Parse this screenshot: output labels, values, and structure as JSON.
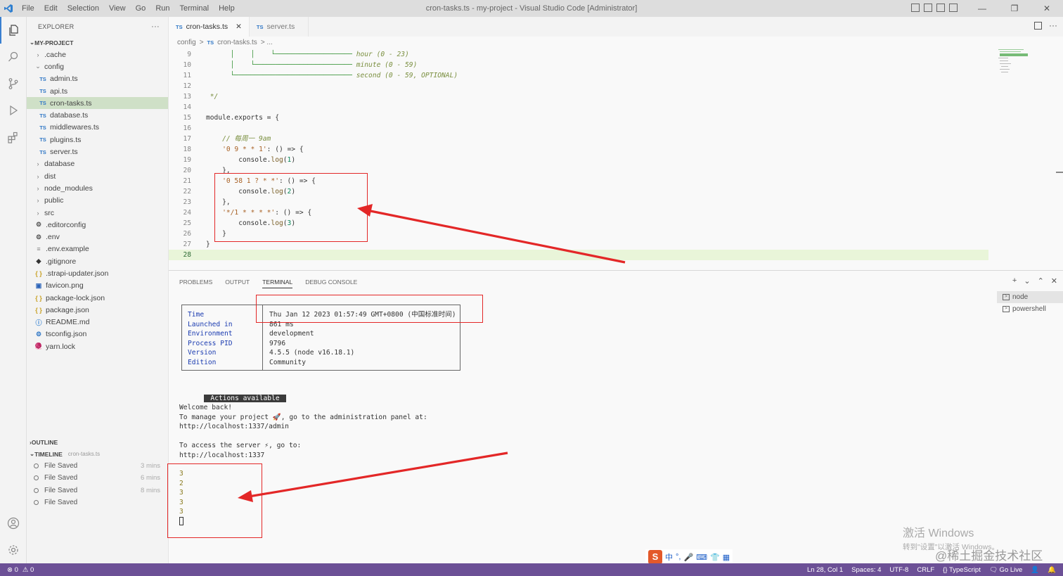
{
  "window": {
    "title": "cron-tasks.ts - my-project - Visual Studio Code [Administrator]",
    "menu": [
      "File",
      "Edit",
      "Selection",
      "View",
      "Go",
      "Run",
      "Terminal",
      "Help"
    ],
    "controls": [
      "—",
      "❐",
      "✕"
    ]
  },
  "sidebar": {
    "header": "EXPLORER",
    "more": "···",
    "project": "MY-PROJECT",
    "items": [
      {
        "label": ".cache",
        "icon": "folder-icon",
        "kind": "folder",
        "expanded": false,
        "indent": 1
      },
      {
        "label": "config",
        "icon": "folder-icon",
        "kind": "folder",
        "expanded": true,
        "indent": 1
      },
      {
        "label": "admin.ts",
        "icon": "ts-file-icon",
        "kind": "ts",
        "indent": 2
      },
      {
        "label": "api.ts",
        "icon": "ts-file-icon",
        "kind": "ts",
        "indent": 2
      },
      {
        "label": "cron-tasks.ts",
        "icon": "ts-file-icon",
        "kind": "ts",
        "indent": 2,
        "selected": true
      },
      {
        "label": "database.ts",
        "icon": "ts-file-icon",
        "kind": "ts",
        "indent": 2
      },
      {
        "label": "middlewares.ts",
        "icon": "ts-file-icon",
        "kind": "ts",
        "indent": 2
      },
      {
        "label": "plugins.ts",
        "icon": "ts-file-icon",
        "kind": "ts",
        "indent": 2
      },
      {
        "label": "server.ts",
        "icon": "ts-file-icon",
        "kind": "ts",
        "indent": 2
      },
      {
        "label": "database",
        "icon": "folder-icon",
        "kind": "folder",
        "expanded": false,
        "indent": 1
      },
      {
        "label": "dist",
        "icon": "folder-icon",
        "kind": "folder",
        "expanded": false,
        "indent": 1
      },
      {
        "label": "node_modules",
        "icon": "folder-icon",
        "kind": "folder",
        "expanded": false,
        "indent": 1
      },
      {
        "label": "public",
        "icon": "folder-icon",
        "kind": "folder",
        "expanded": false,
        "indent": 1
      },
      {
        "label": "src",
        "icon": "folder-icon",
        "kind": "folder",
        "expanded": false,
        "indent": 1
      },
      {
        "label": ".editorconfig",
        "icon": "gear-icon",
        "kind": "gear",
        "indent": 1
      },
      {
        "label": ".env",
        "icon": "gear-icon",
        "kind": "gear",
        "indent": 1
      },
      {
        "label": ".env.example",
        "icon": "text-file-icon",
        "kind": "text",
        "indent": 1
      },
      {
        "label": ".gitignore",
        "icon": "git-icon",
        "kind": "git",
        "indent": 1
      },
      {
        "label": ".strapi-updater.json",
        "icon": "json-icon",
        "kind": "json",
        "indent": 1
      },
      {
        "label": "favicon.png",
        "icon": "image-icon",
        "kind": "image",
        "indent": 1
      },
      {
        "label": "package-lock.json",
        "icon": "json-icon",
        "kind": "json",
        "indent": 1
      },
      {
        "label": "package.json",
        "icon": "json-icon",
        "kind": "json",
        "indent": 1
      },
      {
        "label": "README.md",
        "icon": "markdown-icon",
        "kind": "md",
        "indent": 1
      },
      {
        "label": "tsconfig.json",
        "icon": "tsconfig-icon",
        "kind": "tsconfig",
        "indent": 1
      },
      {
        "label": "yarn.lock",
        "icon": "yarn-icon",
        "kind": "yarn",
        "indent": 1
      }
    ],
    "outline": "OUTLINE",
    "timeline": "TIMELINE",
    "timeline_file": "cron-tasks.ts",
    "timeline_items": [
      {
        "label": "File Saved",
        "ago": "3 mins"
      },
      {
        "label": "File Saved",
        "ago": "6 mins"
      },
      {
        "label": "File Saved",
        "ago": "8 mins"
      },
      {
        "label": "File Saved",
        "ago": ""
      }
    ]
  },
  "tabs": [
    {
      "label": "cron-tasks.ts",
      "badge": "TS",
      "active": true,
      "close": "✕"
    },
    {
      "label": "server.ts",
      "badge": "TS",
      "active": false,
      "close": ""
    }
  ],
  "breadcrumb": {
    "folder": "config",
    "sep": ">",
    "file": "cron-tasks.ts",
    "badge": "TS",
    "tail": "> ..."
  },
  "editor": {
    "current_line": 28,
    "lines": [
      {
        "n": 9,
        "parts": [
          {
            "t": "      │    │    └─────────────────── ",
            "c": "c-guide"
          },
          {
            "t": "hour (0 - 23)",
            "c": "c-comment"
          }
        ]
      },
      {
        "n": 10,
        "parts": [
          {
            "t": "      │    └──────────────────────── ",
            "c": "c-guide"
          },
          {
            "t": "minute (0 - 59)",
            "c": "c-comment"
          }
        ]
      },
      {
        "n": 11,
        "parts": [
          {
            "t": "      └───────────────────────────── ",
            "c": "c-guide"
          },
          {
            "t": "second (0 - 59, OPTIONAL)",
            "c": "c-comment"
          }
        ]
      },
      {
        "n": 12,
        "parts": []
      },
      {
        "n": 13,
        "parts": [
          {
            "t": " */",
            "c": "c-comment"
          }
        ]
      },
      {
        "n": 14,
        "parts": []
      },
      {
        "n": 15,
        "parts": [
          {
            "t": "module.exports = {",
            "c": "c-plain"
          }
        ]
      },
      {
        "n": 16,
        "parts": []
      },
      {
        "n": 17,
        "parts": [
          {
            "t": "    // 每周一 9am",
            "c": "c-comment"
          }
        ]
      },
      {
        "n": 18,
        "parts": [
          {
            "t": "    '0 9 * * 1'",
            "c": "c-str"
          },
          {
            "t": ": () => {",
            "c": "c-plain"
          }
        ]
      },
      {
        "n": 19,
        "parts": [
          {
            "t": "        console.",
            "c": "c-plain"
          },
          {
            "t": "log",
            "c": "c-fn"
          },
          {
            "t": "(",
            "c": "c-plain"
          },
          {
            "t": "1",
            "c": "c-num"
          },
          {
            "t": ")",
            "c": "c-plain"
          }
        ]
      },
      {
        "n": 20,
        "parts": [
          {
            "t": "    },",
            "c": "c-plain"
          }
        ]
      },
      {
        "n": 21,
        "parts": [
          {
            "t": "    '0 58 1 ? * *'",
            "c": "c-str"
          },
          {
            "t": ": () => {",
            "c": "c-plain"
          }
        ]
      },
      {
        "n": 22,
        "parts": [
          {
            "t": "        console.",
            "c": "c-plain"
          },
          {
            "t": "log",
            "c": "c-fn"
          },
          {
            "t": "(",
            "c": "c-plain"
          },
          {
            "t": "2",
            "c": "c-num"
          },
          {
            "t": ")",
            "c": "c-plain"
          }
        ]
      },
      {
        "n": 23,
        "parts": [
          {
            "t": "    },",
            "c": "c-plain"
          }
        ]
      },
      {
        "n": 24,
        "parts": [
          {
            "t": "    '*/1 * * * *'",
            "c": "c-str"
          },
          {
            "t": ": () => {",
            "c": "c-plain"
          }
        ]
      },
      {
        "n": 25,
        "parts": [
          {
            "t": "        console.",
            "c": "c-plain"
          },
          {
            "t": "log",
            "c": "c-fn"
          },
          {
            "t": "(",
            "c": "c-plain"
          },
          {
            "t": "3",
            "c": "c-num"
          },
          {
            "t": ")",
            "c": "c-plain"
          }
        ]
      },
      {
        "n": 26,
        "parts": [
          {
            "t": "    }",
            "c": "c-plain"
          }
        ]
      },
      {
        "n": 27,
        "parts": [
          {
            "t": "}",
            "c": "c-plain"
          }
        ]
      },
      {
        "n": 28,
        "parts": []
      }
    ]
  },
  "panel": {
    "tabs": [
      {
        "label": "PROBLEMS",
        "active": false
      },
      {
        "label": "OUTPUT",
        "active": false
      },
      {
        "label": "TERMINAL",
        "active": true
      },
      {
        "label": "DEBUG CONSOLE",
        "active": false
      }
    ],
    "actions": [
      "+",
      "⌄",
      "⌃",
      "✕"
    ],
    "terminals": [
      {
        "label": "node",
        "active": true
      },
      {
        "label": "powershell",
        "active": false
      }
    ]
  },
  "terminal": {
    "info": [
      {
        "k": "Time",
        "v": "Thu Jan 12 2023 01:57:49 GMT+0800 (中国标准时间)"
      },
      {
        "k": "Launched in",
        "v": "861 ms"
      },
      {
        "k": "Environment",
        "v": "development"
      },
      {
        "k": "Process PID",
        "v": "9796"
      },
      {
        "k": "Version",
        "v": "4.5.5 (node v16.18.1)"
      },
      {
        "k": "Edition",
        "v": "Community"
      }
    ],
    "actions_label": " Actions available ",
    "welcome": "Welcome back!",
    "manage_text": "To manage your project 🚀, go to the administration panel at:",
    "admin_url": "http://localhost:1337/admin",
    "server_text": "To access the server ⚡, go to:",
    "server_url": "http://localhost:1337",
    "output": [
      "3",
      "2",
      "3",
      "3",
      "3"
    ]
  },
  "ime": {
    "logo": "S",
    "items": [
      "中",
      "°,",
      "🎤",
      "⌨",
      "👕",
      "▦"
    ]
  },
  "activate": {
    "line1": "激活 Windows",
    "line2": "转到\"设置\"以激活 Windows。"
  },
  "watermark": "@稀土掘金技术社区",
  "statusbar": {
    "errors": "⊗ 0",
    "warnings": "⚠ 0",
    "items": [
      "Ln 28, Col 1",
      "Spaces: 4",
      "UTF-8",
      "CRLF",
      "{} TypeScript",
      "🗨 Go Live",
      "👤",
      "🔔"
    ]
  },
  "colors": {
    "accent": "#6c5096",
    "annotation": "#e32727",
    "selection": "#cfe0c7"
  }
}
